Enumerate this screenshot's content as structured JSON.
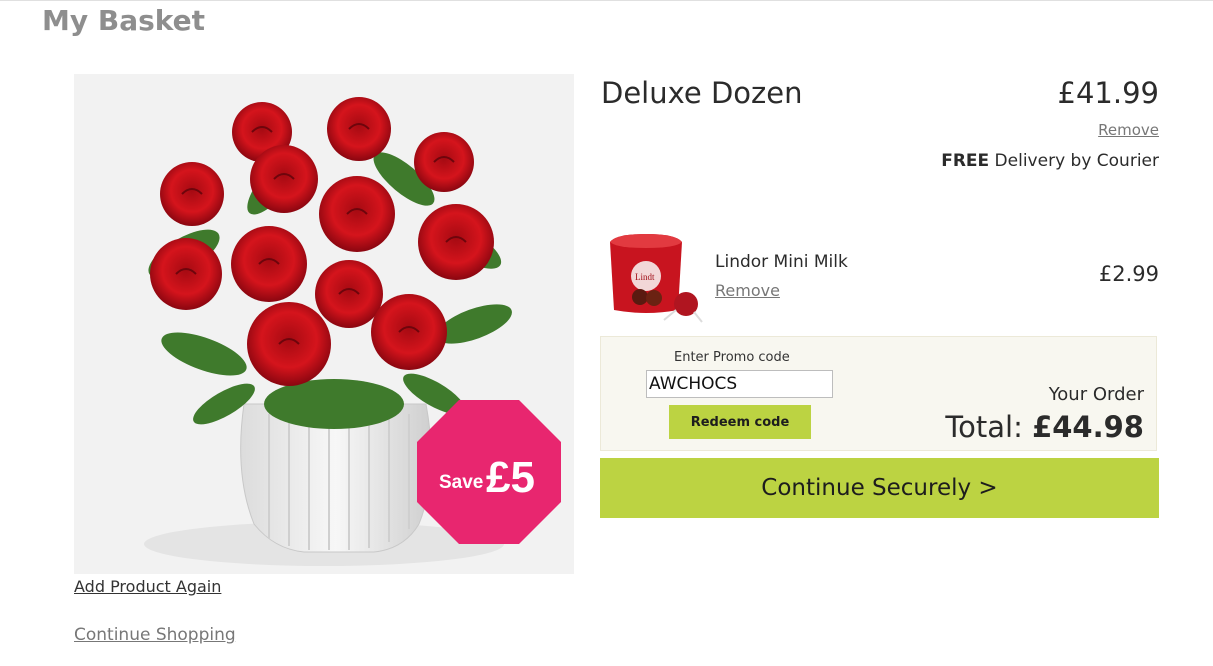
{
  "page": {
    "title": "My Basket"
  },
  "product": {
    "name": "Deluxe Dozen",
    "price": "£41.99",
    "remove_label": "Remove",
    "delivery_strong": "FREE",
    "delivery_text": " Delivery by Courier",
    "image_icon": "red-roses-bouquet-image",
    "badge": {
      "prefix": "Save",
      "amount": "£5",
      "color": "#e8266f"
    }
  },
  "links": {
    "add_again": "Add Product Again",
    "continue_shopping": "Continue Shopping"
  },
  "addon": {
    "name": "Lindor Mini Milk",
    "remove_label": "Remove",
    "price": "£2.99",
    "image_icon": "lindor-chocolate-box-image"
  },
  "promo": {
    "label": "Enter Promo code",
    "value": "AWCHOCS",
    "button_label": "Redeem code"
  },
  "order": {
    "label": "Your Order",
    "total_label": "Total: ",
    "total_value": "£44.98"
  },
  "checkout": {
    "button_label": "Continue Securely >"
  },
  "colors": {
    "accent": "#bcd342",
    "badge": "#e8266f",
    "panel": "#f8f7f0"
  }
}
